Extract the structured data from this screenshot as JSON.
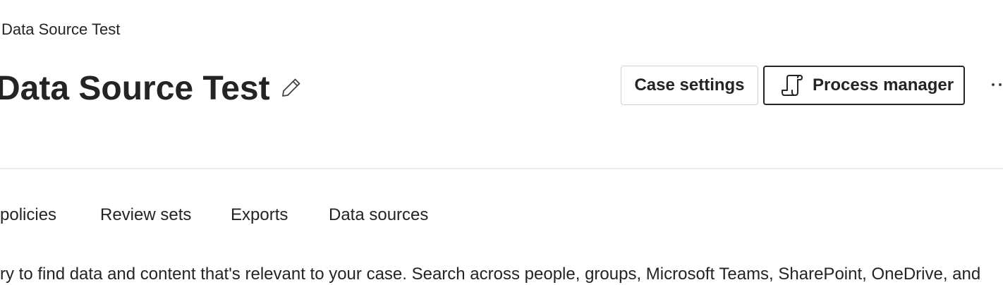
{
  "breadcrumb": {
    "label": "Data Source Test"
  },
  "header": {
    "title": "Data Source Test",
    "edit_icon": "pencil-icon"
  },
  "actions": {
    "case_settings_label": "Case settings",
    "process_manager_label": "Process manager",
    "process_manager_icon": "scroll-document-icon",
    "more_icon": "more-horizontal-icon"
  },
  "tabs": [
    {
      "label": "policies"
    },
    {
      "label": "Review sets"
    },
    {
      "label": "Exports"
    },
    {
      "label": "Data sources"
    }
  ],
  "main": {
    "description": "ry to find data and content that's relevant to your case. Search across people, groups, Microsoft Teams, SharePoint, OneDrive, and"
  },
  "colors": {
    "text": "#242424",
    "border": "#d1d1d1",
    "divider": "#ebebeb",
    "background": "#ffffff"
  }
}
